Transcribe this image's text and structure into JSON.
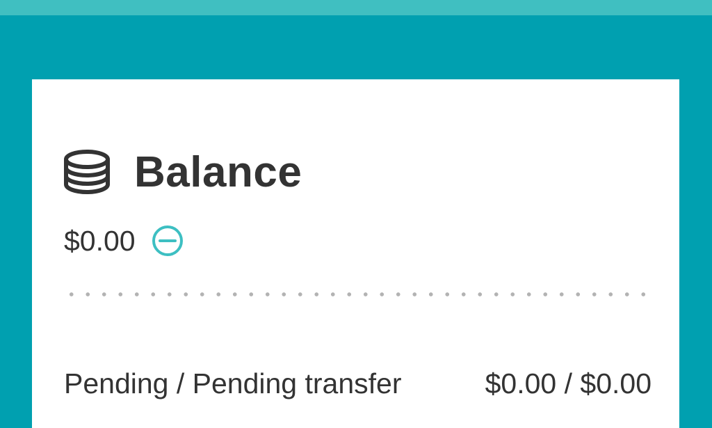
{
  "header": {
    "title": "Balance",
    "icon": "coins-icon"
  },
  "balance": {
    "amount": "$0.00",
    "toggle_icon": "minus-circle-icon"
  },
  "pending": {
    "label": "Pending / Pending transfer",
    "value": "$0.00 / $0.00"
  },
  "colors": {
    "background": "#00a0b0",
    "top_strip": "#40bfc1",
    "card": "#ffffff",
    "text": "#333333",
    "accent": "#3dbfc2",
    "divider_dots": "#b3b3b3"
  }
}
